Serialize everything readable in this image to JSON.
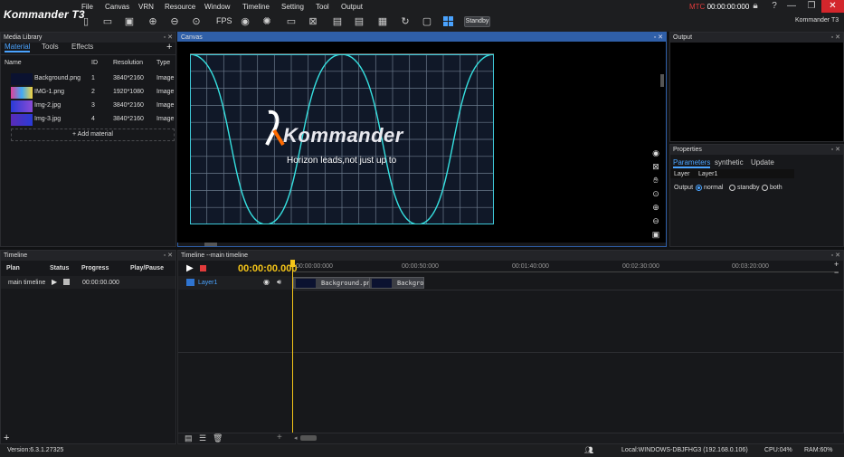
{
  "app": {
    "logo": "Kommander T3",
    "name": "Kommander T3",
    "mtc_label": "MTC",
    "mtc_time": "00:00:00:000"
  },
  "menu": [
    "File",
    "Canvas",
    "VRN",
    "Resource",
    "Window",
    "Timeline",
    "Setting",
    "Tool",
    "Output"
  ],
  "toolbar": {
    "fps": "FPS",
    "standby": "Standby"
  },
  "media_library": {
    "title": "Media Library",
    "tabs": [
      "Material",
      "Tools",
      "Effects"
    ],
    "columns": [
      "Name",
      "ID",
      "Resolution",
      "Type"
    ],
    "rows": [
      {
        "name": "Background.png",
        "id": "1",
        "resolution": "3840*2160",
        "type": "Image"
      },
      {
        "name": "IMG-1.png",
        "id": "2",
        "resolution": "1920*1080",
        "type": "Image"
      },
      {
        "name": "Img-2.jpg",
        "id": "3",
        "resolution": "3840*2160",
        "type": "Image"
      },
      {
        "name": "Img-3.jpg",
        "id": "4",
        "resolution": "3840*2160",
        "type": "Image"
      }
    ],
    "add_material": "Add material"
  },
  "canvas": {
    "title": "Canvas",
    "brand": "Kommander",
    "slogan": "Horizon leads,not just up to"
  },
  "output": {
    "title": "Output"
  },
  "properties": {
    "title": "Properties",
    "tabs": [
      "Parameters",
      "synthetic",
      "Update"
    ],
    "layer_label": "Layer",
    "layer_value": "Layer1",
    "output_label": "Output",
    "output_options": [
      "normal",
      "standby",
      "both"
    ],
    "output_selected": "normal"
  },
  "timeline_list": {
    "title": "Timeline",
    "columns": [
      "Plan",
      "Status",
      "Progress",
      "Play/Pause"
    ],
    "rows": [
      {
        "plan": "main timeline",
        "progress": "00:00:00.000"
      }
    ]
  },
  "timeline_main": {
    "title": "Timeline --main timeline",
    "timecode": "00:00:00.000",
    "ruler": [
      "00:00:00:000",
      "00:00:50:000",
      "00:01:40:000",
      "00:02:30:000",
      "00:03:20:000"
    ],
    "layer": "Layer1",
    "clips": [
      "Background.png",
      "Backgrour"
    ]
  },
  "statusbar": {
    "version": "Version:6.3.1.27325",
    "local": "Local:WINDOWS-DBJFHG3 (192.168.0.106)",
    "cpu": "CPU:04%",
    "ram": "RAM:60%"
  },
  "colors": {
    "accent": "#4aa3ff",
    "timecode": "#f5c518",
    "close": "#d3262c",
    "wave": "#36e0e0",
    "mtc": "#e23b3b"
  }
}
